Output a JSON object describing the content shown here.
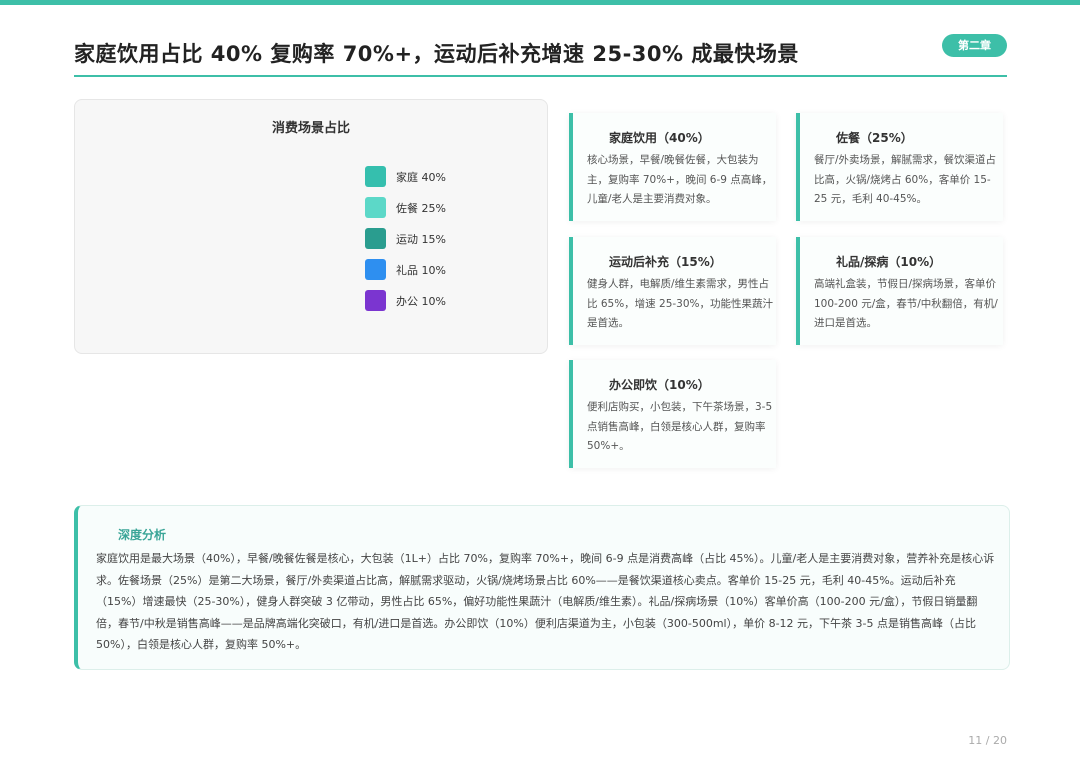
{
  "header": {
    "title": "家庭饮用占比 40% 复购率 70%+，运动后补充增速 25-30% 成最快场景",
    "chapter": "第二章"
  },
  "chart_data": {
    "type": "pie",
    "title": "消费场景占比",
    "categories": [
      "家庭",
      "佐餐",
      "运动",
      "礼品",
      "办公"
    ],
    "values": [
      40,
      25,
      15,
      10,
      10
    ],
    "legend_labels": [
      "家庭 40%",
      "佐餐 25%",
      "运动 15%",
      "礼品 10%",
      "办公 10%"
    ],
    "colors": [
      "#35bfae",
      "#5cd8c8",
      "#2a9d8f",
      "#2e8ff0",
      "#7b35d0"
    ],
    "legend_position": "right"
  },
  "cards": [
    {
      "title": "家庭饮用（40%）",
      "body": "核心场景，早餐/晚餐佐餐，大包装为主，复购率 70%+，晚间 6-9 点高峰，儿童/老人是主要消费对象。"
    },
    {
      "title": "佐餐（25%）",
      "body": "餐厅/外卖场景，解腻需求，餐饮渠道占比高，火锅/烧烤占 60%，客单价 15-25 元，毛利 40-45%。"
    },
    {
      "title": "运动后补充（15%）",
      "body": "健身人群，电解质/维生素需求，男性占比 65%，增速 25-30%，功能性果蔬汁是首选。"
    },
    {
      "title": "礼品/探病（10%）",
      "body": "高端礼盒装，节假日/探病场景，客单价 100-200 元/盒，春节/中秋翻倍，有机/进口是首选。"
    },
    {
      "title": "办公即饮（10%）",
      "body": "便利店购买，小包装，下午茶场景，3-5 点销售高峰，白领是核心人群，复购率 50%+。"
    }
  ],
  "analysis": {
    "title": "深度分析",
    "body": "家庭饮用是最大场景（40%），早餐/晚餐佐餐是核心，大包装（1L+）占比 70%，复购率 70%+，晚间 6-9 点是消费高峰（占比 45%）。儿童/老人是主要消费对象，营养补充是核心诉求。佐餐场景（25%）是第二大场景，餐厅/外卖渠道占比高，解腻需求驱动，火锅/烧烤场景占比 60%——是餐饮渠道核心卖点。客单价 15-25 元，毛利 40-45%。运动后补充（15%）增速最快（25-30%），健身人群突破 3 亿带动，男性占比 65%，偏好功能性果蔬汁（电解质/维生素）。礼品/探病场景（10%）客单价高（100-200 元/盒），节假日销量翻倍，春节/中秋是销售高峰——是品牌高端化突破口，有机/进口是首选。办公即饮（10%）便利店渠道为主，小包装（300-500ml），单价 8-12 元，下午茶 3-5 点是销售高峰（占比 50%），白领是核心人群，复购率 50%+。"
  },
  "footer": {
    "page": "11 / 20"
  }
}
